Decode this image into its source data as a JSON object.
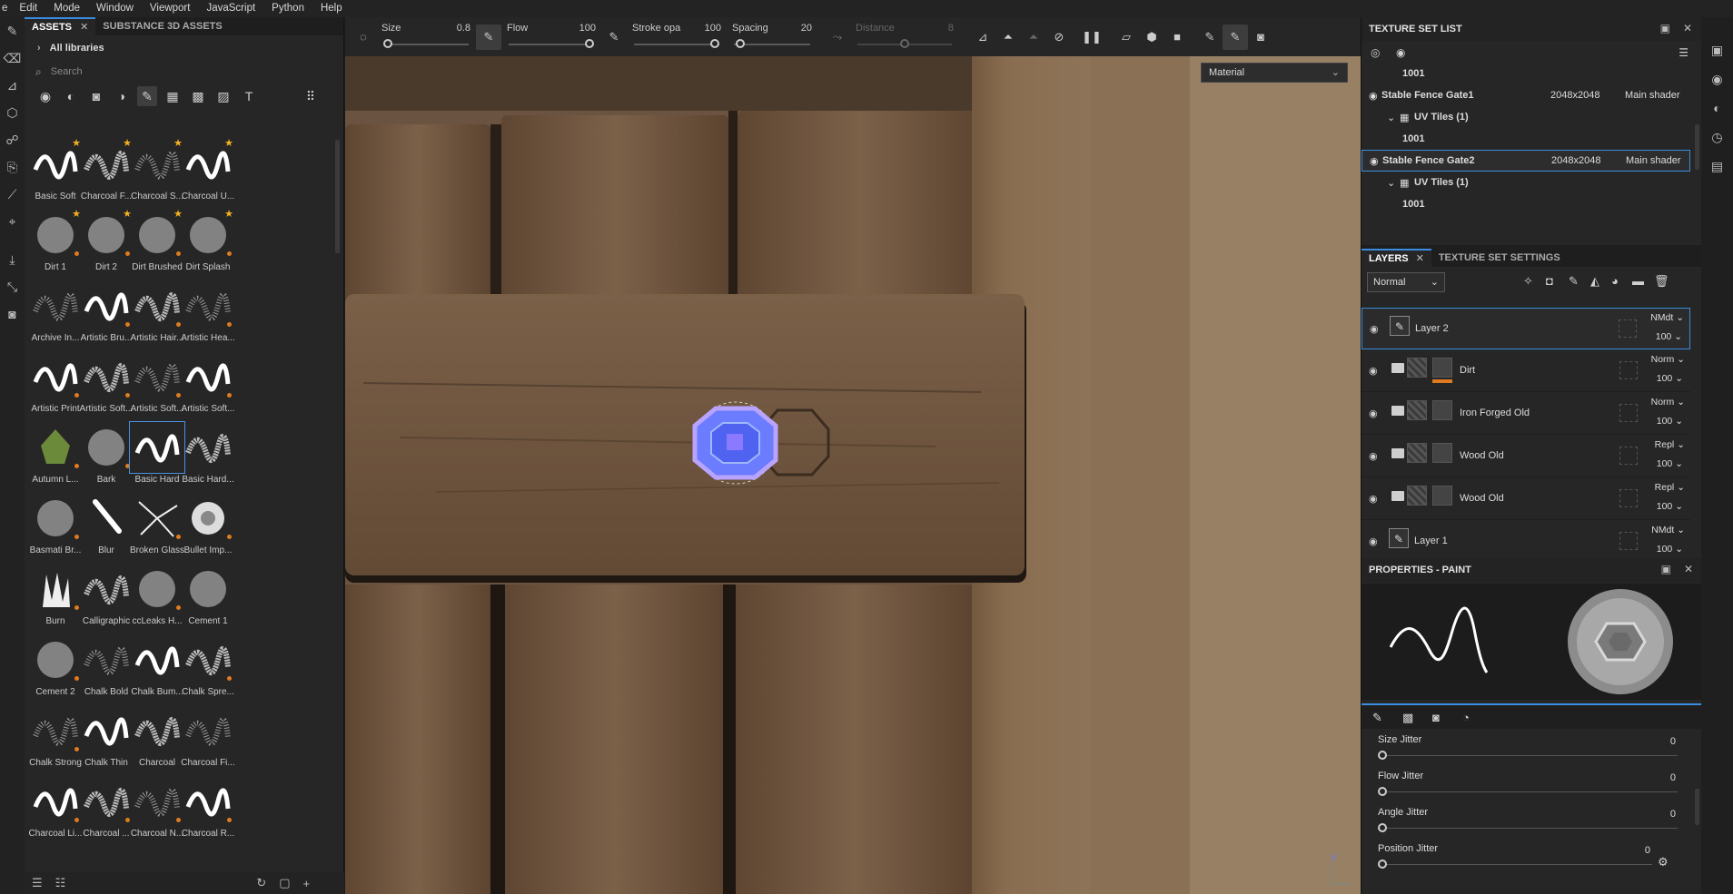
{
  "menu": [
    "e",
    "Edit",
    "Mode",
    "Window",
    "Viewport",
    "JavaScript",
    "Python",
    "Help"
  ],
  "assets": {
    "tabs": [
      "ASSETS",
      "SUBSTANCE 3D ASSETS"
    ],
    "library": "All libraries",
    "search_placeholder": "Search",
    "brushes": [
      {
        "label": "Basic Soft",
        "star": true,
        "dot": false
      },
      {
        "label": "Charcoal F...",
        "star": true,
        "dot": false
      },
      {
        "label": "Charcoal S...",
        "star": true,
        "dot": false
      },
      {
        "label": "Charcoal U...",
        "star": true,
        "dot": false
      },
      {
        "label": "Dirt 1",
        "star": true,
        "dot": true
      },
      {
        "label": "Dirt 2",
        "star": true,
        "dot": true
      },
      {
        "label": "Dirt Brushed",
        "star": true,
        "dot": true
      },
      {
        "label": "Dirt Splash",
        "star": true,
        "dot": true
      },
      {
        "label": "Archive In...",
        "star": false,
        "dot": false
      },
      {
        "label": "Artistic Bru...",
        "star": false,
        "dot": true
      },
      {
        "label": "Artistic Hair...",
        "star": false,
        "dot": true
      },
      {
        "label": "Artistic Hea...",
        "star": false,
        "dot": true
      },
      {
        "label": "Artistic Print",
        "star": false,
        "dot": true
      },
      {
        "label": "Artistic Soft...",
        "star": false,
        "dot": true
      },
      {
        "label": "Artistic Soft...",
        "star": false,
        "dot": true
      },
      {
        "label": "Artistic Soft...",
        "star": false,
        "dot": true
      },
      {
        "label": "Autumn L...",
        "star": false,
        "dot": true
      },
      {
        "label": "Bark",
        "star": false,
        "dot": true
      },
      {
        "label": "Basic Hard",
        "star": false,
        "dot": false
      },
      {
        "label": "Basic Hard...",
        "star": false,
        "dot": false
      },
      {
        "label": "Basmati Br...",
        "star": false,
        "dot": true
      },
      {
        "label": "Blur",
        "star": false,
        "dot": false
      },
      {
        "label": "Broken Glass",
        "star": false,
        "dot": true
      },
      {
        "label": "Bullet Imp...",
        "star": false,
        "dot": true
      },
      {
        "label": "Burn",
        "star": false,
        "dot": true
      },
      {
        "label": "Calligraphic",
        "star": false,
        "dot": false
      },
      {
        "label": "ccLeaks H...",
        "star": false,
        "dot": true
      },
      {
        "label": "Cement 1",
        "star": false,
        "dot": false
      },
      {
        "label": "Cement 2",
        "star": false,
        "dot": true
      },
      {
        "label": "Chalk Bold",
        "star": false,
        "dot": false
      },
      {
        "label": "Chalk Bum...",
        "star": false,
        "dot": false
      },
      {
        "label": "Chalk Spre...",
        "star": false,
        "dot": true
      },
      {
        "label": "Chalk Strong",
        "star": false,
        "dot": true
      },
      {
        "label": "Chalk Thin",
        "star": false,
        "dot": false
      },
      {
        "label": "Charcoal",
        "star": false,
        "dot": false
      },
      {
        "label": "Charcoal Fi...",
        "star": false,
        "dot": false
      },
      {
        "label": "Charcoal Li...",
        "star": false,
        "dot": true
      },
      {
        "label": "Charcoal ...",
        "star": false,
        "dot": true
      },
      {
        "label": "Charcoal N...",
        "star": false,
        "dot": true
      },
      {
        "label": "Charcoal R...",
        "star": false,
        "dot": true
      }
    ]
  },
  "toolbar": {
    "size_label": "Size",
    "size_value": "0.8",
    "flow_label": "Flow",
    "flow_value": "100",
    "stroke_label": "Stroke opa",
    "stroke_value": "100",
    "spacing_label": "Spacing",
    "spacing_value": "20",
    "distance_label": "Distance",
    "distance_value": "8"
  },
  "viewport": {
    "material_select": "Material"
  },
  "texture_set_list": {
    "title": "TEXTURE SET LIST",
    "rows": [
      {
        "type": "tile",
        "text": "1001"
      },
      {
        "type": "set",
        "name": "Stable Fence Gate1",
        "res": "2048x2048",
        "shader": "Main shader",
        "selected": false
      },
      {
        "type": "uv",
        "text": "UV Tiles (1)"
      },
      {
        "type": "tile",
        "text": "1001"
      },
      {
        "type": "set",
        "name": "Stable Fence Gate2",
        "res": "2048x2048",
        "shader": "Main shader",
        "selected": true
      },
      {
        "type": "uv",
        "text": "UV Tiles (1)"
      },
      {
        "type": "tile",
        "text": "1001"
      }
    ]
  },
  "layers_panel": {
    "tab_layers": "LAYERS",
    "tab_settings": "TEXTURE SET SETTINGS",
    "blend_mode": "Normal",
    "layers": [
      {
        "name": "Layer 2",
        "blend": "NMdt",
        "opacity": "100",
        "kind": "paint",
        "selected": true
      },
      {
        "name": "Dirt",
        "blend": "Norm",
        "opacity": "100",
        "kind": "folder",
        "selected": false
      },
      {
        "name": "Iron Forged Old",
        "blend": "Norm",
        "opacity": "100",
        "kind": "folder",
        "selected": false
      },
      {
        "name": "Wood Old",
        "blend": "Repl",
        "opacity": "100",
        "kind": "folder",
        "selected": false
      },
      {
        "name": "Wood Old",
        "blend": "Repl",
        "opacity": "100",
        "kind": "folder",
        "selected": false
      },
      {
        "name": "Layer 1",
        "blend": "NMdt",
        "opacity": "100",
        "kind": "paint",
        "selected": false
      }
    ]
  },
  "properties": {
    "title": "PROPERTIES - PAINT",
    "params": [
      {
        "label": "Size Jitter",
        "value": "0"
      },
      {
        "label": "Flow Jitter",
        "value": "0"
      },
      {
        "label": "Angle Jitter",
        "value": "0"
      },
      {
        "label": "Position Jitter",
        "value": "0"
      }
    ]
  },
  "colors": {
    "accent": "#3a8de0",
    "star": "#f5b021",
    "dot": "#e07a20",
    "dirt_mask": "#e07a20"
  }
}
